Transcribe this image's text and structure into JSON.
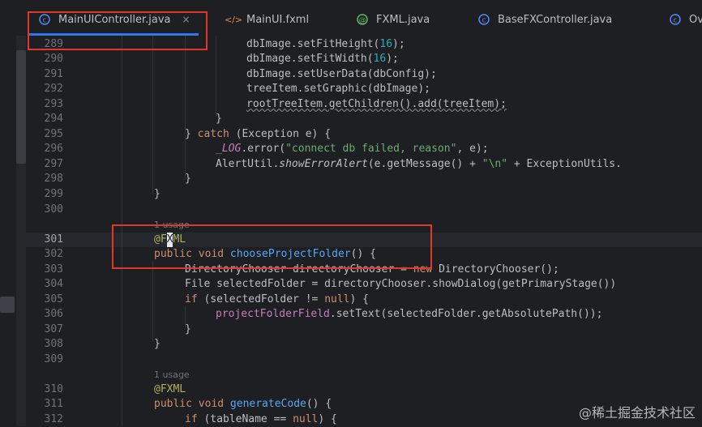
{
  "tabs": [
    {
      "label": "MainUIController.java",
      "icon": "class-c-icon",
      "active": true
    },
    {
      "label": "MainUI.fxml",
      "icon": "xml-tag-icon",
      "active": false
    },
    {
      "label": "FXML.java",
      "icon": "annotation-icon",
      "active": false
    },
    {
      "label": "BaseFXController.java",
      "icon": "class-c-icon",
      "active": false
    },
    {
      "label": "Ov",
      "icon": "class-c-icon",
      "active": false
    }
  ],
  "close_glyph": "×",
  "usage_1": "1 usage",
  "usage_2": "1 usage",
  "line_numbers": [
    "289",
    "290",
    "291",
    "292",
    "293",
    "294",
    "295",
    "296",
    "297",
    "298",
    "299",
    "300",
    "301",
    "302",
    "303",
    "304",
    "305",
    "306",
    "307",
    "308",
    "309",
    "310",
    "311",
    "312"
  ],
  "code": {
    "l289": "dbImage.setFitHeight(16);",
    "l290": "dbImage.setFitWidth(16);",
    "l291": "dbImage.setUserData(dbConfig);",
    "l292": "treeItem.setGraphic(dbImage);",
    "l293": "rootTreeItem.getChildren().add(treeItem);",
    "l294": "}",
    "l295": "} catch (Exception e) {",
    "l296": "_LOG.error(\"connect db failed, reason\", e);",
    "l297": "AlertUtil.showErrorAlert(e.getMessage() + \"\\n\" + ExceptionUtils.",
    "l298": "}",
    "l299": "}",
    "l301": "@FXML",
    "l302": "public void chooseProjectFolder() {",
    "l303": "DirectoryChooser directoryChooser = new DirectoryChooser();",
    "l304": "File selectedFolder = directoryChooser.showDialog(getPrimaryStage())",
    "l305": "if (selectedFolder != null) {",
    "l306": "projectFolderField.setText(selectedFolder.getAbsolutePath());",
    "l307": "}",
    "l308": "}",
    "l310": "@FXML",
    "l311": "public void generateCode() {",
    "l312": "if (tableName == null) {"
  },
  "watermark": "@稀土掘金技术社区",
  "colors": {
    "background": "#1e1f22",
    "keyword": "#cf8e6d",
    "function": "#56a8f5",
    "number": "#2aacb8",
    "string": "#6aab73",
    "annotation": "#b3ae60",
    "field": "#c77dbb",
    "highlight_box": "#e0392b",
    "active_tab_underline": "#3574f0"
  }
}
